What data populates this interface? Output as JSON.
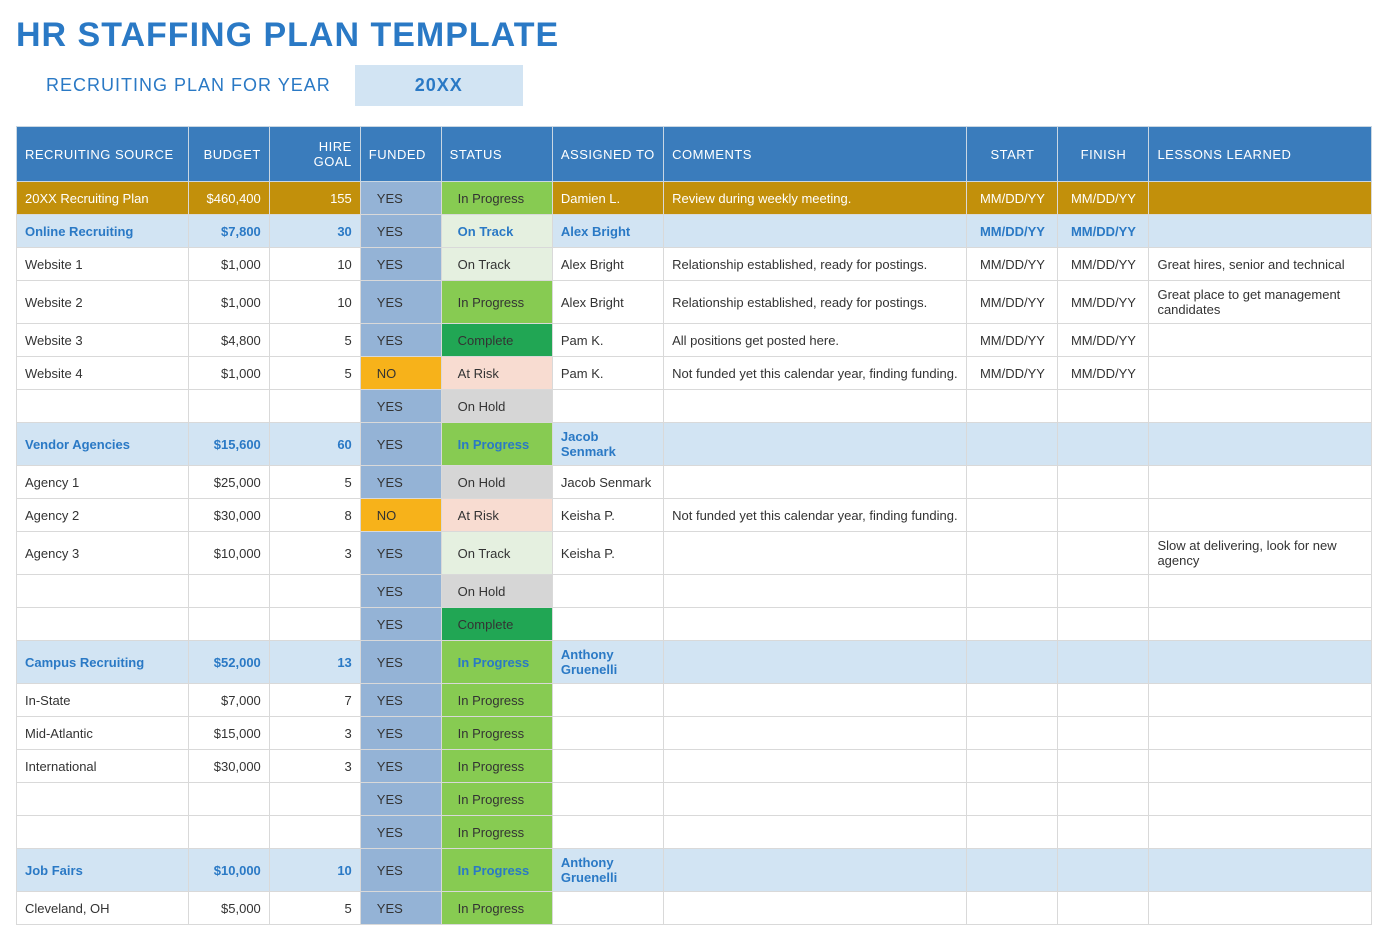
{
  "title": "HR STAFFING PLAN TEMPLATE",
  "subheader": {
    "label": "RECRUITING PLAN FOR YEAR",
    "year": "20XX"
  },
  "columns": [
    {
      "key": "source",
      "label": "RECRUITING SOURCE",
      "align": "left"
    },
    {
      "key": "budget",
      "label": "BUDGET",
      "align": "right"
    },
    {
      "key": "hire",
      "label": "HIRE GOAL",
      "align": "right"
    },
    {
      "key": "funded",
      "label": "FUNDED",
      "align": "left"
    },
    {
      "key": "status",
      "label": "STATUS",
      "align": "left"
    },
    {
      "key": "assigned",
      "label": "ASSIGNED TO",
      "align": "left"
    },
    {
      "key": "comments",
      "label": "COMMENTS",
      "align": "left"
    },
    {
      "key": "start",
      "label": "START",
      "align": "center"
    },
    {
      "key": "finish",
      "label": "FINISH",
      "align": "center"
    },
    {
      "key": "lessons",
      "label": "LESSONS LEARNED",
      "align": "left"
    }
  ],
  "rows": [
    {
      "type": "total",
      "source": "20XX Recruiting Plan",
      "budget": "$460,400",
      "hire": "155",
      "funded": "YES",
      "status": "In Progress",
      "assigned": "Damien L.",
      "comments": "Review during weekly meeting.",
      "start": "MM/DD/YY",
      "finish": "MM/DD/YY",
      "lessons": ""
    },
    {
      "type": "section",
      "source": "Online Recruiting",
      "budget": "$7,800",
      "hire": "30",
      "funded": "YES",
      "status": "On Track",
      "assigned": "Alex Bright",
      "comments": "",
      "start": "MM/DD/YY",
      "finish": "MM/DD/YY",
      "lessons": ""
    },
    {
      "type": "item",
      "source": "Website 1",
      "budget": "$1,000",
      "hire": "10",
      "funded": "YES",
      "status": "On Track",
      "assigned": "Alex Bright",
      "comments": "Relationship established, ready for postings.",
      "start": "MM/DD/YY",
      "finish": "MM/DD/YY",
      "lessons": "Great hires, senior and technical"
    },
    {
      "type": "item",
      "source": "Website 2",
      "budget": "$1,000",
      "hire": "10",
      "funded": "YES",
      "status": "In Progress",
      "assigned": "Alex Bright",
      "comments": "Relationship established, ready for postings.",
      "start": "MM/DD/YY",
      "finish": "MM/DD/YY",
      "lessons": "Great place to get management candidates"
    },
    {
      "type": "item",
      "source": "Website 3",
      "budget": "$4,800",
      "hire": "5",
      "funded": "YES",
      "status": "Complete",
      "assigned": "Pam K.",
      "comments": "All positions get posted here.",
      "start": "MM/DD/YY",
      "finish": "MM/DD/YY",
      "lessons": ""
    },
    {
      "type": "item",
      "source": "Website 4",
      "budget": "$1,000",
      "hire": "5",
      "funded": "NO",
      "status": "At Risk",
      "assigned": "Pam K.",
      "comments": "Not funded yet this calendar year, finding funding.",
      "start": "MM/DD/YY",
      "finish": "MM/DD/YY",
      "lessons": ""
    },
    {
      "type": "item",
      "source": "",
      "budget": "",
      "hire": "",
      "funded": "YES",
      "status": "On Hold",
      "assigned": "",
      "comments": "",
      "start": "",
      "finish": "",
      "lessons": ""
    },
    {
      "type": "section",
      "source": "Vendor Agencies",
      "budget": "$15,600",
      "hire": "60",
      "funded": "YES",
      "status": "In Progress",
      "assigned": "Jacob Senmark",
      "comments": "",
      "start": "",
      "finish": "",
      "lessons": ""
    },
    {
      "type": "item",
      "source": "Agency 1",
      "budget": "$25,000",
      "hire": "5",
      "funded": "YES",
      "status": "On Hold",
      "assigned": "Jacob Senmark",
      "comments": "",
      "start": "",
      "finish": "",
      "lessons": ""
    },
    {
      "type": "item",
      "source": "Agency 2",
      "budget": "$30,000",
      "hire": "8",
      "funded": "NO",
      "status": "At Risk",
      "assigned": "Keisha P.",
      "comments": "Not funded yet this calendar year, finding funding.",
      "start": "",
      "finish": "",
      "lessons": ""
    },
    {
      "type": "item",
      "source": "Agency 3",
      "budget": "$10,000",
      "hire": "3",
      "funded": "YES",
      "status": "On Track",
      "assigned": "Keisha P.",
      "comments": "",
      "start": "",
      "finish": "",
      "lessons": "Slow at delivering, look for new agency"
    },
    {
      "type": "item",
      "source": "",
      "budget": "",
      "hire": "",
      "funded": "YES",
      "status": "On Hold",
      "assigned": "",
      "comments": "",
      "start": "",
      "finish": "",
      "lessons": ""
    },
    {
      "type": "item",
      "source": "",
      "budget": "",
      "hire": "",
      "funded": "YES",
      "status": "Complete",
      "assigned": "",
      "comments": "",
      "start": "",
      "finish": "",
      "lessons": ""
    },
    {
      "type": "section",
      "source": "Campus Recruiting",
      "budget": "$52,000",
      "hire": "13",
      "funded": "YES",
      "status": "In Progress",
      "assigned": "Anthony Gruenelli",
      "comments": "",
      "start": "",
      "finish": "",
      "lessons": ""
    },
    {
      "type": "item",
      "source": "In-State",
      "budget": "$7,000",
      "hire": "7",
      "funded": "YES",
      "status": "In Progress",
      "assigned": "",
      "comments": "",
      "start": "",
      "finish": "",
      "lessons": ""
    },
    {
      "type": "item",
      "source": "Mid-Atlantic",
      "budget": "$15,000",
      "hire": "3",
      "funded": "YES",
      "status": "In Progress",
      "assigned": "",
      "comments": "",
      "start": "",
      "finish": "",
      "lessons": ""
    },
    {
      "type": "item",
      "source": "International",
      "budget": "$30,000",
      "hire": "3",
      "funded": "YES",
      "status": "In Progress",
      "assigned": "",
      "comments": "",
      "start": "",
      "finish": "",
      "lessons": ""
    },
    {
      "type": "item",
      "source": "",
      "budget": "",
      "hire": "",
      "funded": "YES",
      "status": "In Progress",
      "assigned": "",
      "comments": "",
      "start": "",
      "finish": "",
      "lessons": ""
    },
    {
      "type": "item",
      "source": "",
      "budget": "",
      "hire": "",
      "funded": "YES",
      "status": "In Progress",
      "assigned": "",
      "comments": "",
      "start": "",
      "finish": "",
      "lessons": ""
    },
    {
      "type": "section",
      "source": "Job Fairs",
      "budget": "$10,000",
      "hire": "10",
      "funded": "YES",
      "status": "In Progress",
      "assigned": "Anthony Gruenelli",
      "comments": "",
      "start": "",
      "finish": "",
      "lessons": ""
    },
    {
      "type": "item",
      "source": "Cleveland, OH",
      "budget": "$5,000",
      "hire": "5",
      "funded": "YES",
      "status": "In Progress",
      "assigned": "",
      "comments": "",
      "start": "",
      "finish": "",
      "lessons": ""
    }
  ],
  "statusClasses": {
    "In Progress": "status-in-progress",
    "On Track": "status-on-track",
    "Complete": "status-complete",
    "At Risk": "status-at-risk",
    "On Hold": "status-on-hold"
  }
}
